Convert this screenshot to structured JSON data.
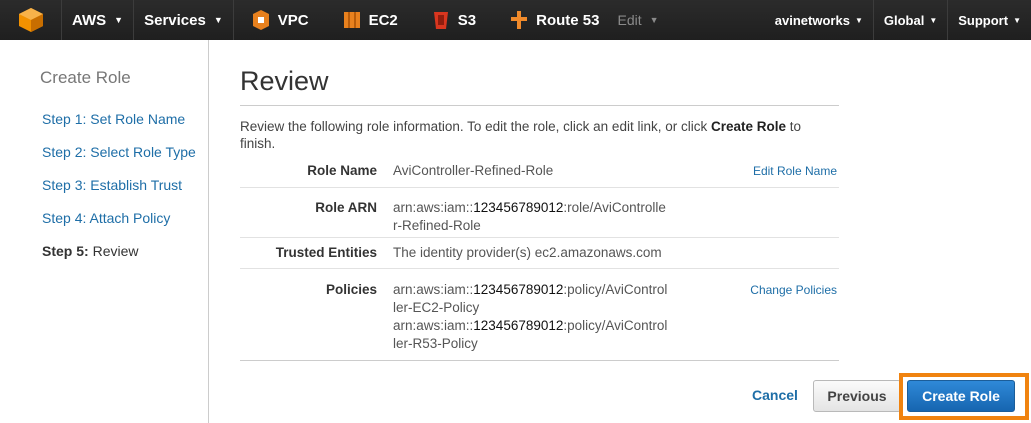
{
  "nav": {
    "aws_label": "AWS",
    "services_label": "Services",
    "services": [
      {
        "label": "VPC",
        "icon": "vpc-icon",
        "color": "#e8811e"
      },
      {
        "label": "EC2",
        "icon": "ec2-icon",
        "color": "#e8811e"
      },
      {
        "label": "S3",
        "icon": "s3-icon",
        "color": "#d9361f"
      },
      {
        "label": "Route 53",
        "icon": "route53-icon",
        "color": "#f08a2b"
      }
    ],
    "edit_label": "Edit",
    "account_label": "avinetworks",
    "region_label": "Global",
    "support_label": "Support"
  },
  "sidebar": {
    "title": "Create Role",
    "steps": [
      {
        "label": "Step 1: Set Role Name"
      },
      {
        "label": "Step 2: Select Role Type"
      },
      {
        "label": "Step 3: Establish Trust"
      },
      {
        "label": "Step 4: Attach Policy"
      }
    ],
    "current_step_prefix": "Step 5:",
    "current_step_label": "Review"
  },
  "main": {
    "title": "Review",
    "intro_before": "Review the following role information. To edit the role, click an edit link, or click ",
    "intro_bold": "Create Role",
    "intro_after": " to finish.",
    "role_name": {
      "label": "Role Name",
      "value": "AviController-Refined-Role",
      "edit_link": "Edit Role Name"
    },
    "role_arn": {
      "label": "Role ARN",
      "prefix": "arn:aws:iam::",
      "account": "123456789012",
      "line1_rest": ":role/AviControlle",
      "line2": "r-Refined-Role"
    },
    "trusted": {
      "label": "Trusted Entities",
      "value": "The identity provider(s) ec2.amazonaws.com"
    },
    "policies": {
      "label": "Policies",
      "edit_link": "Change Policies",
      "items": [
        {
          "prefix": "arn:aws:iam::",
          "account": "123456789012",
          "line1_rest": ":policy/AviControl",
          "line2": "ler-EC2-Policy"
        },
        {
          "prefix": "arn:aws:iam::",
          "account": "123456789012",
          "line1_rest": ":policy/AviControl",
          "line2": "ler-R53-Policy"
        }
      ]
    }
  },
  "actions": {
    "cancel_label": "Cancel",
    "previous_label": "Previous",
    "create_label": "Create Role",
    "highlight_color": "#f0830f"
  }
}
